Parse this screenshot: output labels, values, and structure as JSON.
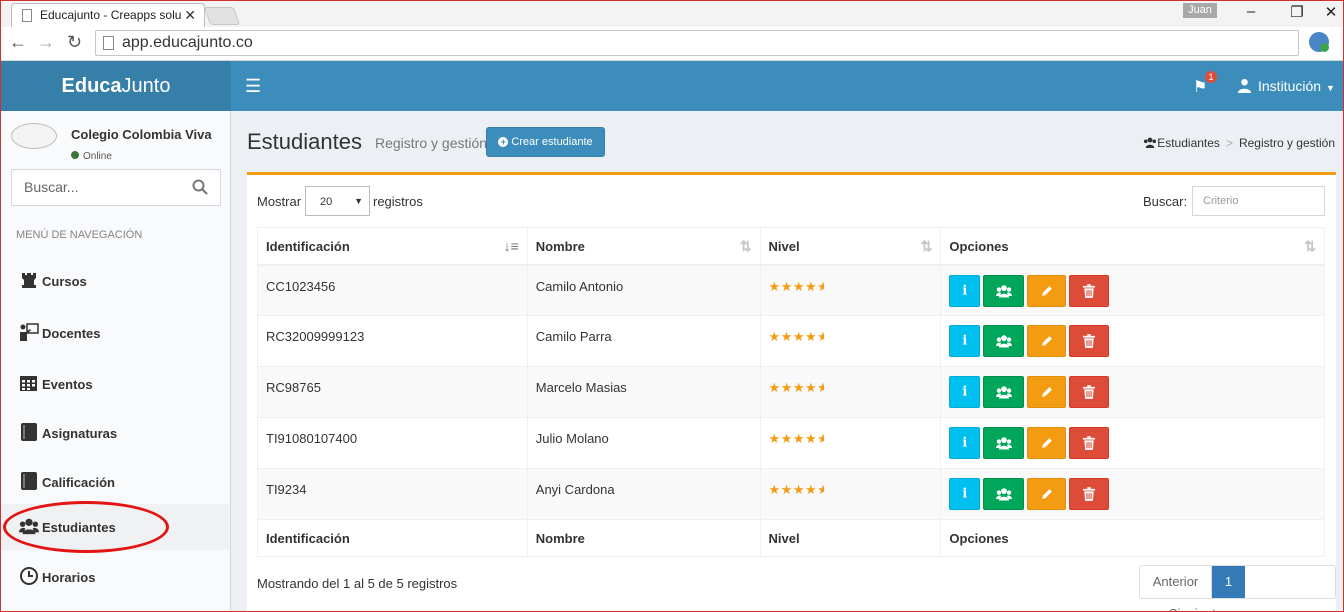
{
  "browser": {
    "tab_title": "Educajunto - Creapps solu",
    "tab_close": "✕",
    "user_badge": "Juan",
    "url": "app.educajunto.co"
  },
  "header": {
    "logo_bold": "Educa",
    "logo_rest": "Junto",
    "notifications_count": "1",
    "user_menu": "Institución"
  },
  "sidebar": {
    "school_name": "Colegio Colombia Viva",
    "status": "Online",
    "search_placeholder": "Buscar...",
    "menu_header": "MENÚ DE NAVEGACIÓN",
    "items": [
      {
        "label": "Cursos",
        "icon": "chess-rook-icon"
      },
      {
        "label": "Docentes",
        "icon": "teacher-board-icon"
      },
      {
        "label": "Eventos",
        "icon": "calendar-icon"
      },
      {
        "label": "Asignaturas",
        "icon": "book-icon"
      },
      {
        "label": "Calificación",
        "icon": "book-icon"
      },
      {
        "label": "Estudiantes",
        "icon": "users-icon"
      },
      {
        "label": "Horarios",
        "icon": "clock-icon"
      }
    ],
    "active_item": "Estudiantes"
  },
  "content": {
    "title": "Estudiantes",
    "subtitle": "Registro y gestión",
    "create_button": "Crear estudiante",
    "breadcrumb": [
      "Estudiantes",
      "Registro y gestión"
    ],
    "show_label": "Mostrar",
    "show_value": "20",
    "records_label": "registros",
    "filter_label": "Buscar:",
    "filter_placeholder": "Criterio",
    "columns": [
      "Identificación",
      "Nombre",
      "Nivel",
      "Opciones"
    ],
    "rows": [
      {
        "id": "CC1023456",
        "name": "Camilo Antonio",
        "rating": 4.5
      },
      {
        "id": "RC32009999123",
        "name": "Camilo Parra",
        "rating": 4.5
      },
      {
        "id": "RC98765",
        "name": "Marcelo Masias",
        "rating": 4.5
      },
      {
        "id": "TI91080107400",
        "name": "Julio Molano",
        "rating": 4.5
      },
      {
        "id": "TI9234",
        "name": "Anyi Cardona",
        "rating": 4.5
      }
    ],
    "info_text": "Mostrando del 1 al 5 de 5 registros",
    "pagination": {
      "prev": "Anterior",
      "current": "1",
      "next": "Siguiente"
    }
  },
  "colors": {
    "header_bg": "#3c8dbc",
    "logo_bg": "#367fa9",
    "box_top": "#f39c12",
    "btn_info": "#00c0ef",
    "btn_group": "#00a65a",
    "btn_edit": "#f39c12",
    "btn_delete": "#dd4b39"
  }
}
